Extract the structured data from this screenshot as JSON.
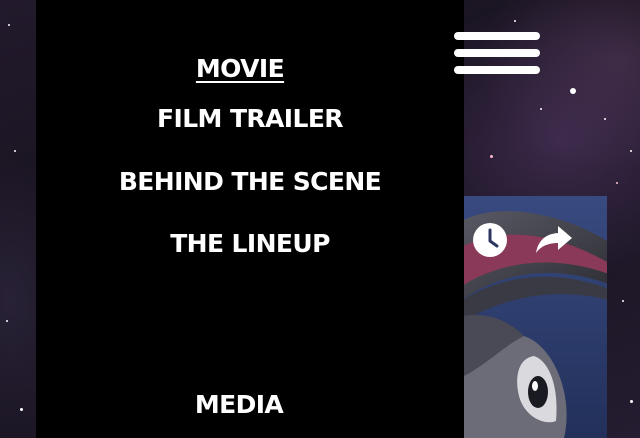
{
  "nav": {
    "items": [
      {
        "id": "movie",
        "label": "MOVIE",
        "active": true
      },
      {
        "id": "film-trailer",
        "label": "FILM TRAILER",
        "active": false
      },
      {
        "id": "behind-the-scene",
        "label": "BEHIND THE SCENE",
        "active": false
      },
      {
        "id": "the-lineup",
        "label": "THE LINEUP",
        "active": false
      },
      {
        "id": "media",
        "label": "MEDIA",
        "active": false
      }
    ]
  },
  "menu_toggle": {
    "icon": "hamburger-menu-icon"
  },
  "video_card": {
    "icons": [
      "clock-icon",
      "share-arrow-icon"
    ]
  },
  "colors": {
    "panel": "#000000",
    "text": "#ffffff",
    "background": "#1a1420"
  }
}
